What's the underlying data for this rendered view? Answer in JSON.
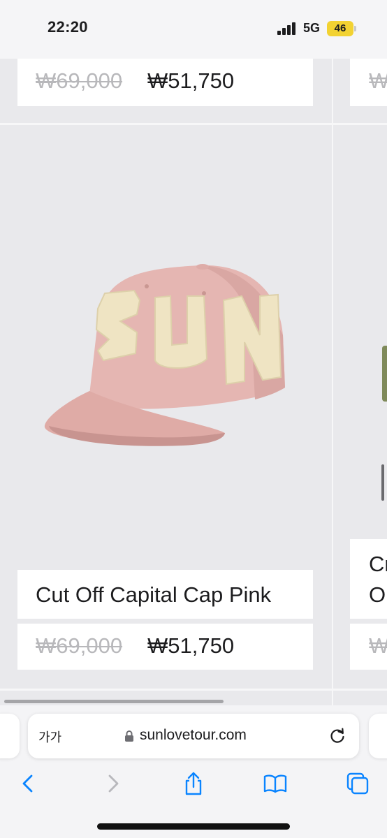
{
  "status_bar": {
    "time": "22:20",
    "network": "5G",
    "battery": "46"
  },
  "products": {
    "top_old_price": "₩69,000",
    "top_new_price": "₩51,750",
    "name": "Cut Off Capital Cap Pink",
    "old_price": "₩69,000",
    "new_price": "₩51,750",
    "cap_letters": [
      "S",
      "U",
      "N"
    ]
  },
  "right_column": {
    "top_price_partial": "₩",
    "name_line1_partial": "Cr",
    "name_line2_partial": "O",
    "price_partial": "₩"
  },
  "browser": {
    "aa_label": "가가",
    "url": "sunlovetour.com"
  },
  "icons": {
    "back": "chevron-left-icon",
    "forward": "chevron-right-icon",
    "share": "share-icon",
    "bookmarks": "book-icon",
    "tabs": "tabs-icon",
    "lock": "lock-icon",
    "reload": "reload-icon"
  },
  "colors": {
    "accent": "#0a84ff",
    "battery": "#f2d232",
    "cap_pink": "#e6b8b4",
    "patch_cream": "#f0e6c6"
  }
}
